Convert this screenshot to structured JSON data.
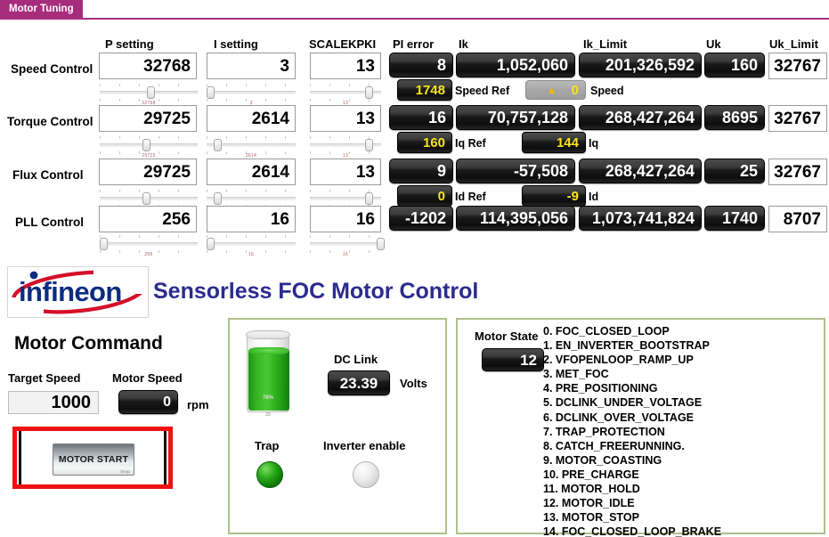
{
  "tab": {
    "label": "Motor Tuning",
    "color": "#a72d7c"
  },
  "tuning": {
    "columns": [
      "P setting",
      "I setting",
      "SCALEKPKI",
      "PI error",
      "Ik",
      "Ik_Limit",
      "Uk",
      "Uk_Limit"
    ],
    "rows": [
      {
        "label": "Speed Control",
        "p_setting": "32768",
        "i_setting": "3",
        "scalekpki": "13",
        "pi_error": "8",
        "ik": "1,052,060",
        "ik_limit": "201,326,592",
        "uk": "160",
        "uk_limit": "32767",
        "sub": [
          {
            "value": "1748",
            "label": "Speed Ref",
            "style": "yellow"
          },
          {
            "value": "0",
            "label": "Speed",
            "style": "warning"
          }
        ]
      },
      {
        "label": "Torque Control",
        "p_setting": "29725",
        "i_setting": "2614",
        "scalekpki": "13",
        "pi_error": "16",
        "ik": "70,757,128",
        "ik_limit": "268,427,264",
        "uk": "8695",
        "uk_limit": "32767",
        "sub": [
          {
            "value": "160",
            "label": "Iq Ref",
            "style": "yellow"
          },
          {
            "value": "144",
            "label": "Iq",
            "style": "yellow"
          }
        ]
      },
      {
        "label": "Flux Control",
        "p_setting": "29725",
        "i_setting": "2614",
        "scalekpki": "13",
        "pi_error": "9",
        "ik": "-57,508",
        "ik_limit": "268,427,264",
        "uk": "25",
        "uk_limit": "32767",
        "sub": [
          {
            "value": "0",
            "label": "Id Ref",
            "style": "yellow"
          },
          {
            "value": "-9",
            "label": "Id",
            "style": "yellow"
          }
        ]
      },
      {
        "label": "PLL Control",
        "p_setting": "256",
        "i_setting": "16",
        "scalekpki": "16",
        "pi_error": "-1202",
        "ik": "114,395,056",
        "ik_limit": "1,073,741,824",
        "uk": "1740",
        "uk_limit": "8707",
        "sub": []
      }
    ],
    "sliders": [
      {
        "value": "32768"
      },
      {
        "value": "3"
      },
      {
        "value": "13"
      },
      {
        "value": "29725"
      },
      {
        "value": "2614"
      },
      {
        "value": "13"
      },
      {
        "value": "29725"
      },
      {
        "value": "2614"
      },
      {
        "value": "13"
      },
      {
        "value": "256"
      },
      {
        "value": "16"
      },
      {
        "value": "16"
      }
    ]
  },
  "brand": {
    "logo_text": "infineon",
    "title": "Sensorless FOC Motor Control",
    "logo_color": "#0a2c82",
    "swoosh_color": "#d40f29",
    "title_color": "#2b2b8f"
  },
  "motor_command": {
    "title": "Motor Command",
    "target_speed_label": "Target Speed",
    "target_speed_value": "1000",
    "motor_speed_label": "Motor Speed",
    "motor_speed_value": "0",
    "unit": "rpm",
    "start_button": "MOTOR START",
    "start_button_sub": "Stop"
  },
  "status_panel": {
    "dc_link_label": "DC Link",
    "dc_link_value": "23.39",
    "dc_link_unit": "Volts",
    "tank_percent": "78%",
    "tank_base": "23",
    "trap_label": "Trap",
    "trap_state": "on",
    "inverter_label": "Inverter enable",
    "inverter_state": "off"
  },
  "state_panel": {
    "motor_state_label": "Motor State",
    "motor_state_value": "12",
    "states": [
      "0. FOC_CLOSED_LOOP",
      "1. EN_INVERTER_BOOTSTRAP",
      "2. VFOPENLOOP_RAMP_UP",
      "3. MET_FOC",
      "4. PRE_POSITIONING",
      "5. DCLINK_UNDER_VOLTAGE",
      "6. DCLINK_OVER_VOLTAGE",
      "7. TRAP_PROTECTION",
      "8. CATCH_FREERUNNING.",
      "9. MOTOR_COASTING",
      "10. PRE_CHARGE",
      "11. MOTOR_HOLD",
      "12. MOTOR_IDLE",
      "13. MOTOR_STOP",
      "14. FOC_CLOSED_LOOP_BRAKE"
    ]
  }
}
